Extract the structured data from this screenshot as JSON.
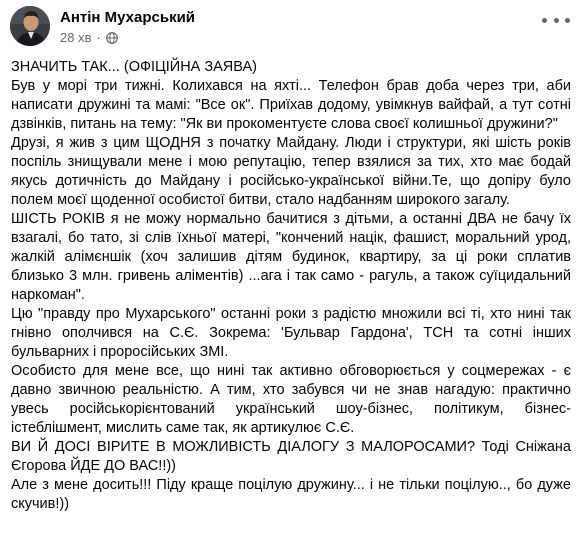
{
  "post": {
    "author": "Антін Мухарський",
    "time": "28 хв",
    "dot": "·",
    "paragraphs": [
      "ЗНАЧИТЬ ТАК... (ОФІЦІЙНА ЗАЯВА)",
      "Був у морі три тижні. Колихався на яхті... Телефон  брав доба через три, аби написати дружині та мамі: \"Все ок\". Приїхав додому, увімкнув вайфай, а тут сотні дзвінків, питань на тему: \"Як ви прокоментуєте слова своєї колишньої дружини?\"",
      "Друзі, я жив з цим ЩОДНЯ з початку Майдану. Люди і структури, які шість років поспіль знищували мене і мою репутацію, тепер взялися за тих, хто має бодай якусь дотичність до Майдану і російсько-української війни.Те, що допіру було полем моєї щоденної особистої битви, стало надбанням широкого загалу.",
      "ШІСТЬ РОКІВ я не можу нормально бачитися з дітьми, а останні ДВА не бачу їх взагалі, бо тато, зі слів їхньої  матері, \"кончений націк, фашист, моральний урод, жалкій алімєншік (хоч залишив дітям будинок, квартиру, за ці роки сплатив близько 3 млн. гривень  аліментів) ...ага і так само -  рагуль, а також суїцидальний наркоман\".",
      "Цю \"правду про Мухарського\" останні роки з радістю множили всі ті, хто нині так гнівно ополчився на С.Є.  Зокрема: 'Бульвар Гардона', ТСН та сотні інших бульварних і проросійських ЗМІ.",
      "Особисто для мене все, що нині так  активно обговорюється у соцмережах - є давно звичною реальністю. А тим, хто забувся чи не знав  нагадую: практично увесь російськорієнтований український шоу-бізнес, політикум, бізнес-істеблішмент, мислить саме так, як артикулює С.Є.",
      "ВИ Й ДОСІ ВІРИТЕ В МОЖЛИВІСТЬ ДІАЛОГУ З МАЛОРОСАМИ? Тоді Сніжана Єгорова ЙДЕ ДО ВАС!!))",
      "Але з мене досить!!! Піду краще поцілую дружину... і не тільки поцілую.., бо дуже скучив!))"
    ]
  },
  "icons": {
    "avatar": "avatar-photo",
    "globe": "globe-icon",
    "more": "more-options-icon"
  },
  "colors": {
    "text": "#050505",
    "meta": "#65676b"
  }
}
